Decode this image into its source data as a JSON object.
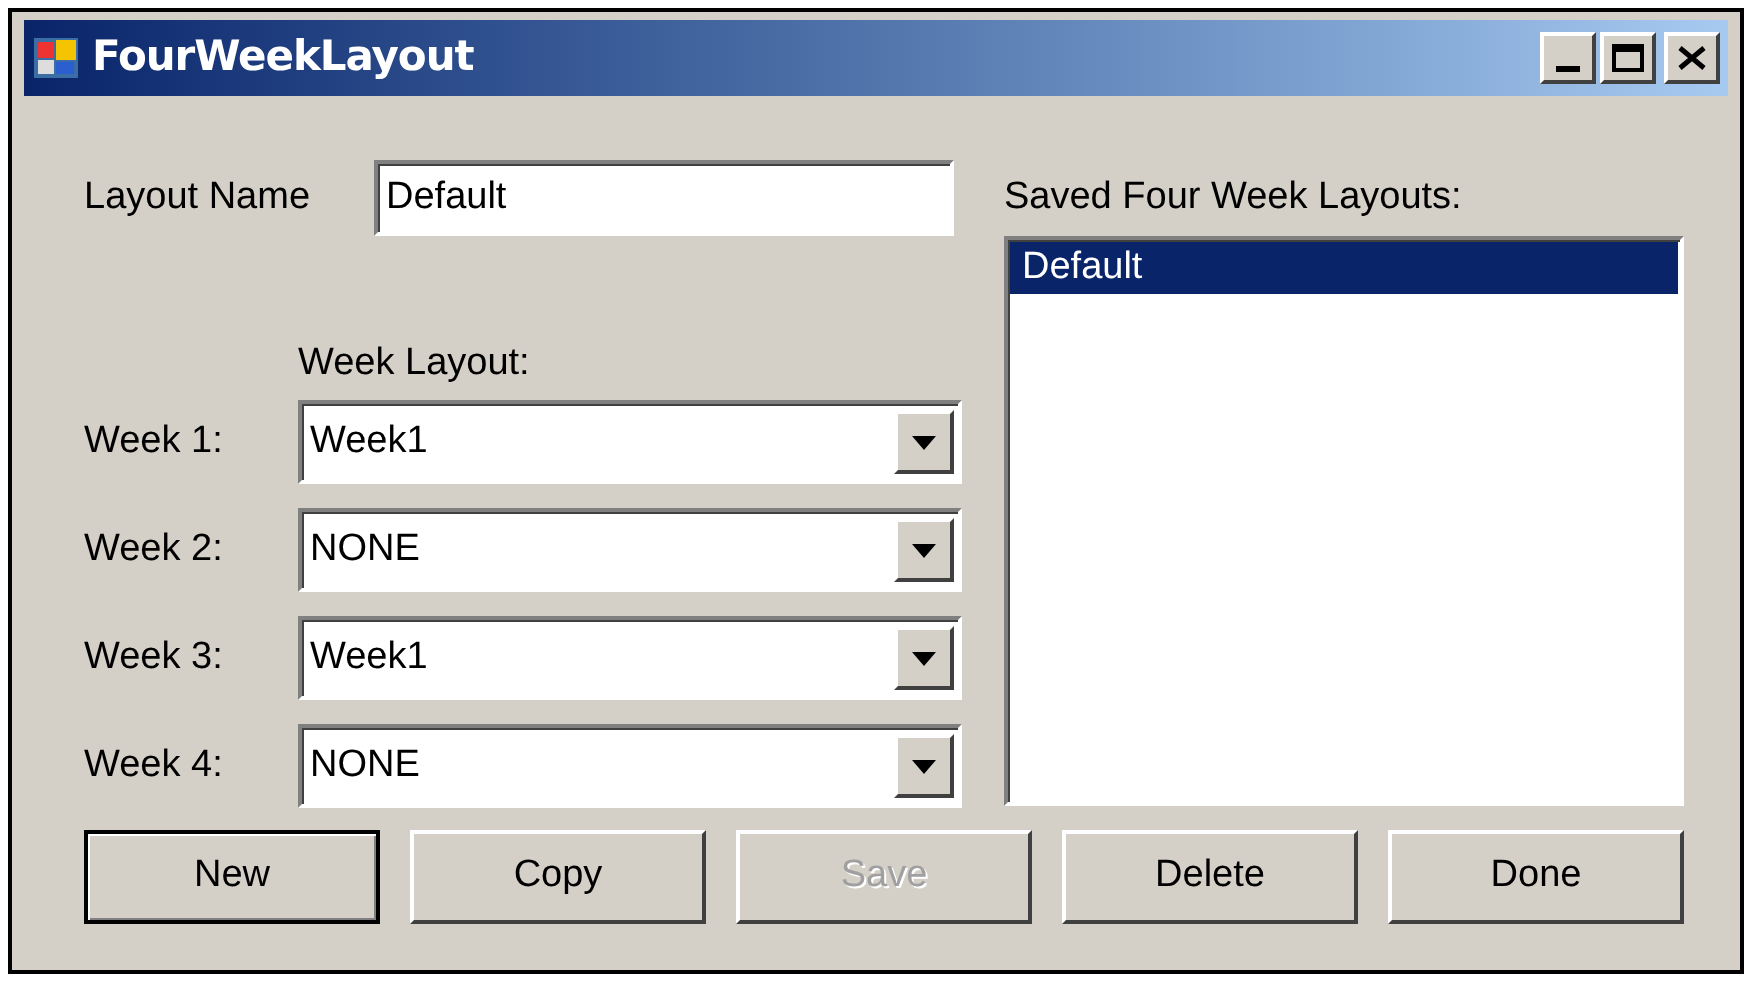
{
  "window": {
    "title": "FourWeekLayout"
  },
  "layout_name": {
    "label": "Layout Name",
    "value": "Default"
  },
  "week_layout_label": "Week Layout:",
  "weeks": [
    {
      "label": "Week 1:",
      "value": "Week1"
    },
    {
      "label": "Week 2:",
      "value": "NONE"
    },
    {
      "label": "Week 3:",
      "value": "Week1"
    },
    {
      "label": "Week 4:",
      "value": "NONE"
    }
  ],
  "saved": {
    "label": "Saved Four Week Layouts:",
    "items": [
      {
        "text": "Default",
        "selected": true
      }
    ]
  },
  "buttons": [
    {
      "label": "New",
      "default": true,
      "disabled": false
    },
    {
      "label": "Copy",
      "default": false,
      "disabled": false
    },
    {
      "label": "Save",
      "default": false,
      "disabled": true
    },
    {
      "label": "Delete",
      "default": false,
      "disabled": false
    },
    {
      "label": "Done",
      "default": false,
      "disabled": false
    }
  ]
}
